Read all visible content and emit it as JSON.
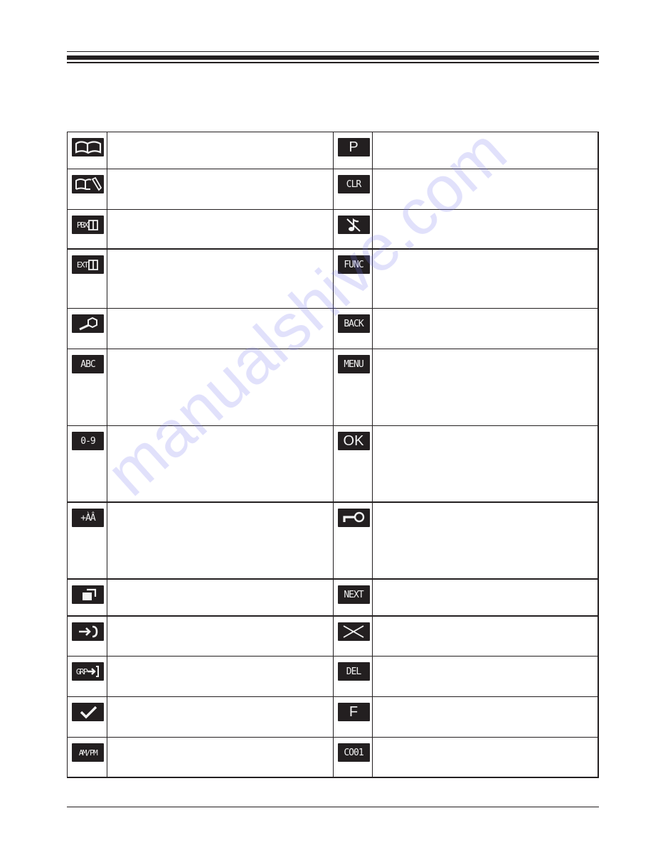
{
  "watermark": "manualshive.com",
  "colors": {
    "ink": "#231f20",
    "lcd_text": "#f2f2f2",
    "watermark": "#7878eb"
  },
  "table": {
    "rows": [
      {
        "left": {
          "icon": "phonebook-icon",
          "label": "",
          "description": ""
        },
        "right": {
          "icon": "pause-icon",
          "label": "P",
          "description": ""
        }
      },
      {
        "left": {
          "icon": "phonebook-edit-icon",
          "label": "",
          "description": ""
        },
        "right": {
          "icon": "clear-icon",
          "label": "CLR",
          "description": ""
        }
      },
      {
        "left": {
          "icon": "pbx-phonebook-icon",
          "label": "PBX",
          "description": ""
        },
        "right": {
          "icon": "ringer-off-icon",
          "label": "",
          "description": ""
        }
      },
      {
        "left": {
          "icon": "extension-phonebook-icon",
          "label": "EXT",
          "description": ""
        },
        "right": {
          "icon": "function-icon",
          "label": "FUNC",
          "description": ""
        }
      },
      {
        "left": {
          "icon": "search-icon",
          "label": "",
          "description": ""
        },
        "right": {
          "icon": "back-icon",
          "label": "BACK",
          "description": ""
        }
      },
      {
        "left": {
          "icon": "alphabet-mode-icon",
          "label": "ABC",
          "description": ""
        },
        "right": {
          "icon": "menu-icon",
          "label": "MENU",
          "description": ""
        }
      },
      {
        "left": {
          "icon": "numeric-mode-icon",
          "label": "0-9",
          "description": ""
        },
        "right": {
          "icon": "ok-icon",
          "label": "OK",
          "description": ""
        }
      },
      {
        "left": {
          "icon": "extended-characters-icon",
          "label": "+ÀÂ",
          "description": ""
        },
        "right": {
          "icon": "key-lock-icon",
          "label": "",
          "description": ""
        }
      },
      {
        "left": {
          "icon": "copy-icon",
          "label": "",
          "description": ""
        },
        "right": {
          "icon": "next-icon",
          "label": "NEXT",
          "description": ""
        }
      },
      {
        "left": {
          "icon": "transfer-icon",
          "label": "",
          "description": ""
        },
        "right": {
          "icon": "cancel-icon",
          "label": "",
          "description": ""
        }
      },
      {
        "left": {
          "icon": "group-transfer-icon",
          "label": "GRP",
          "description": ""
        },
        "right": {
          "icon": "delete-icon",
          "label": "DEL",
          "description": ""
        }
      },
      {
        "left": {
          "icon": "check-icon",
          "label": "",
          "description": ""
        },
        "right": {
          "icon": "flash-icon",
          "label": "F",
          "description": ""
        }
      },
      {
        "left": {
          "icon": "am-pm-icon",
          "label": "AM/PM",
          "description": ""
        },
        "right": {
          "icon": "co-line-icon",
          "label": "CO01",
          "description": ""
        }
      }
    ]
  }
}
